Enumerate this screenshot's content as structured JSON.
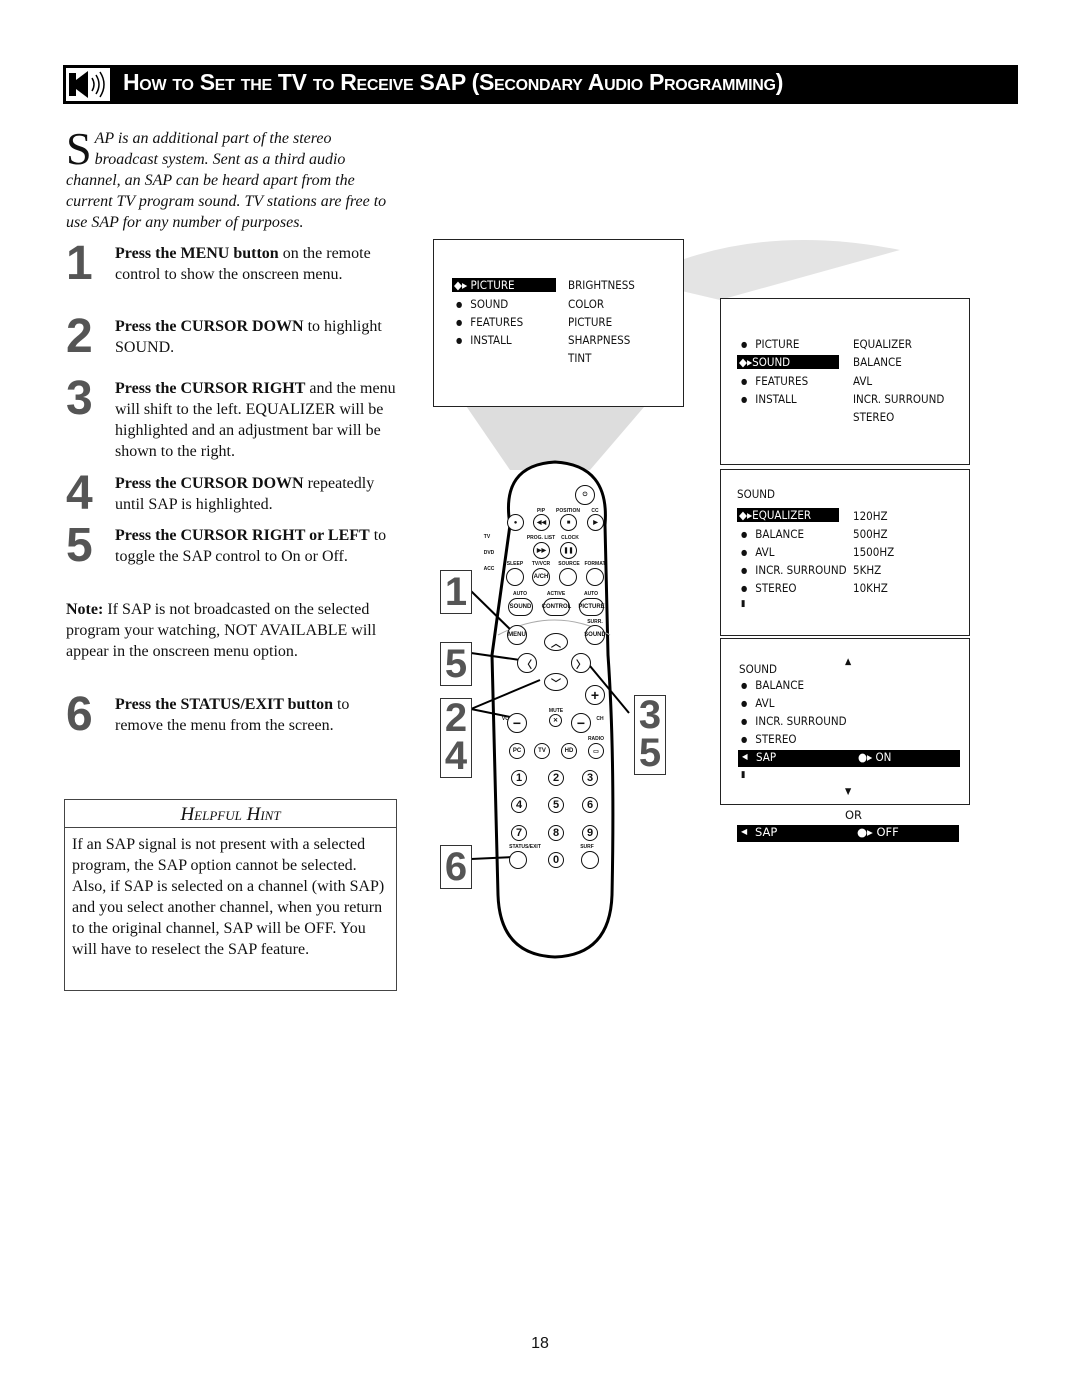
{
  "header": {
    "title": "How to Set the TV to Receive SAP (Secondary Audio Programming)",
    "icon": "speaker-icon"
  },
  "intro": {
    "dropcap": "S",
    "text": "AP is an additional part of the stereo broadcast system.  Sent as a third audio channel, an SAP can be heard apart from the current TV program sound.  TV stations are free to use SAP for any number of purposes."
  },
  "steps": [
    {
      "num": "1",
      "bold": "Press the MENU button",
      "rest": " on the remote control to show the onscreen menu."
    },
    {
      "num": "2",
      "bold": "Press the CURSOR DOWN",
      "rest": " to highlight SOUND."
    },
    {
      "num": "3",
      "bold": "Press the CURSOR RIGHT",
      "rest": " and the menu will shift to the left. EQUALIZER will be highlighted and an adjustment bar will be shown to the right."
    },
    {
      "num": "4",
      "bold": "Press the CURSOR DOWN",
      "rest": " repeatedly until SAP is highlighted."
    },
    {
      "num": "5",
      "bold": "Press the CURSOR RIGHT or LEFT",
      "rest": " to toggle the SAP control to On or Off."
    },
    {
      "num": "6",
      "bold": "Press the STATUS/EXIT button",
      "rest": " to remove the menu from the screen."
    }
  ],
  "note": {
    "label": "Note:",
    "text": " If SAP is not broadcasted on the selected program your watching, NOT AVAILABLE will appear in the onscreen menu option."
  },
  "hint": {
    "title": "Helpful Hint",
    "body": "If an SAP signal is not present with a selected program, the SAP option cannot be selected.  Also, if SAP is selected on a channel (with SAP) and you select another channel, when you return to the original channel, SAP will be OFF.  You will have to reselect the SAP feature."
  },
  "menu1": {
    "left": [
      "PICTURE",
      "SOUND",
      "FEATURES",
      "INSTALL"
    ],
    "right": [
      "BRIGHTNESS",
      "COLOR",
      "PICTURE",
      "SHARPNESS",
      "TINT"
    ]
  },
  "menu2": {
    "left": [
      "PICTURE",
      "SOUND",
      "FEATURES",
      "INSTALL"
    ],
    "right": [
      "EQUALIZER",
      "BALANCE",
      "AVL",
      "INCR. SURROUND",
      "STEREO"
    ]
  },
  "menu3": {
    "title": "SOUND",
    "left": [
      "EQUALIZER",
      "BALANCE",
      "AVL",
      "INCR. SURROUND",
      "STEREO"
    ],
    "right": [
      "120HZ",
      "500HZ",
      "1500HZ",
      "5KHZ",
      "10KHZ"
    ]
  },
  "menu4": {
    "title": "SOUND",
    "items": [
      "BALANCE",
      "AVL",
      "INCR. SURROUND",
      "STEREO"
    ],
    "sap": "SAP",
    "on": "ON",
    "or": "OR",
    "off": "OFF"
  },
  "callouts": [
    "1",
    "5",
    "2",
    "4",
    "6",
    "3",
    "5"
  ],
  "remote": {
    "labels": {
      "pip": "PIP",
      "position": "POSITION",
      "cc": "CC",
      "prog_list": "PROG. LIST",
      "clock": "CLOCK",
      "sleep": "SLEEP",
      "tvvcr": "TV/VCR",
      "source": "SOURCE",
      "format": "FORMAT",
      "auto1": "AUTO",
      "active": "ACTIVE",
      "auto2": "AUTO",
      "surr": "SURR.",
      "vol": "VOL",
      "mute": "MUTE",
      "ch": "CH",
      "radio": "RADIO",
      "status": "STATUS/EXIT",
      "surf": "SURF",
      "tv": "TV",
      "dvd": "DVD",
      "acc": "ACC"
    },
    "buttons": {
      "ach": "A/CH",
      "sound": "SOUND",
      "control": "CONTROL",
      "picture": "PICTURE",
      "menu": "MENU",
      "surr_sound": "SOUND",
      "pc": "PC",
      "tv": "TV",
      "hd": "HD",
      "digits": [
        "1",
        "2",
        "3",
        "4",
        "5",
        "6",
        "7",
        "8",
        "9",
        "0"
      ]
    }
  },
  "page_number": "18"
}
